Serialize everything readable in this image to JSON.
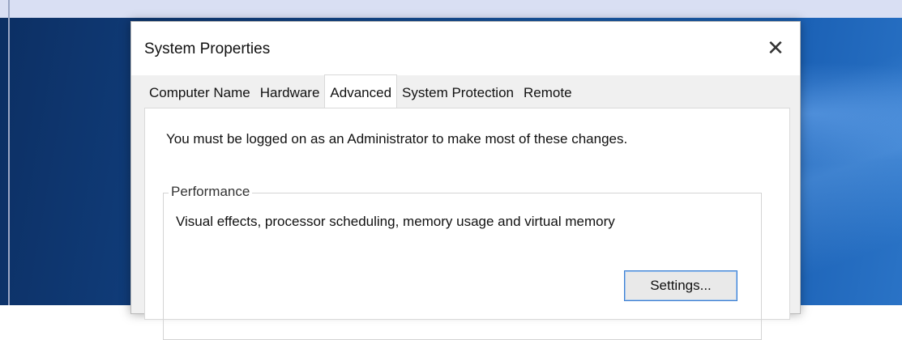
{
  "dialog": {
    "title": "System Properties",
    "close_symbol": "✕",
    "tabs": [
      {
        "label": "Computer Name",
        "active": false
      },
      {
        "label": "Hardware",
        "active": false
      },
      {
        "label": "Advanced",
        "active": true
      },
      {
        "label": "System Protection",
        "active": false
      },
      {
        "label": "Remote",
        "active": false
      }
    ],
    "notice": "You must be logged on as an Administrator to make most of these changes.",
    "performance": {
      "legend": "Performance",
      "description": "Visual effects, processor scheduling, memory usage and virtual memory",
      "settings_label": "Settings..."
    }
  },
  "colors": {
    "dialog_bg": "#f0f0f0",
    "panel_bg": "#ffffff",
    "focus_border": "#3c7fd1",
    "desktop_accent": "#124385"
  },
  "icons": {
    "close": "close-icon"
  }
}
